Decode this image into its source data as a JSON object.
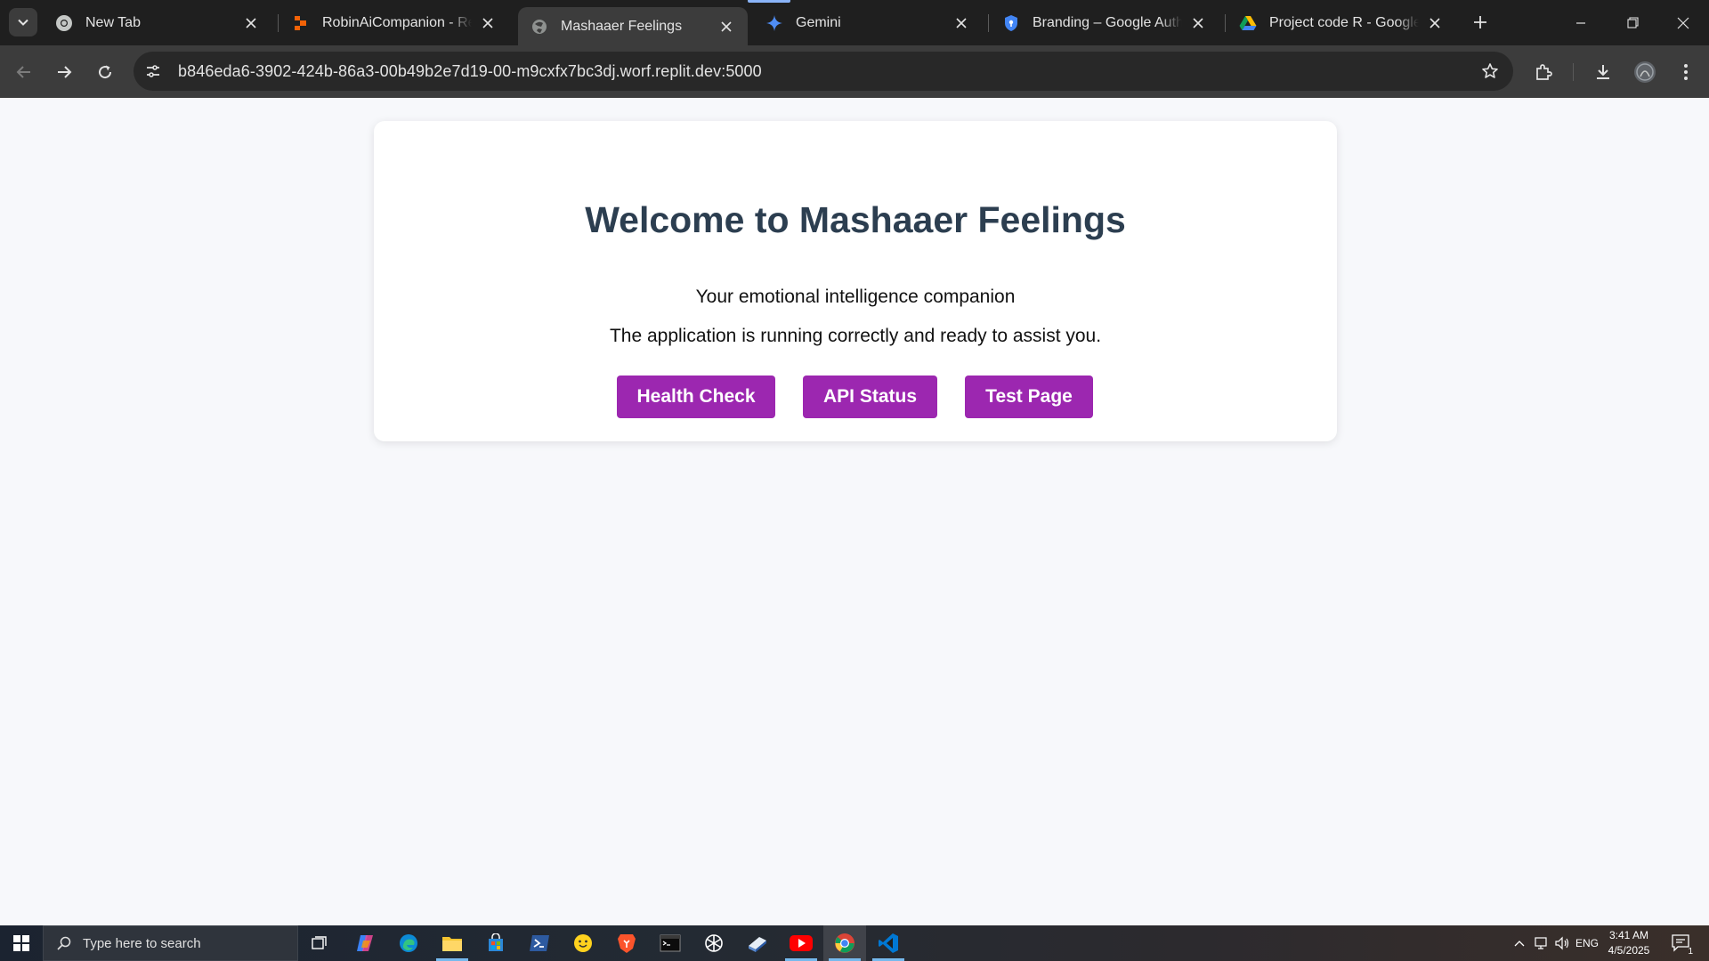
{
  "browser": {
    "tabs": [
      {
        "title": "New Tab",
        "favicon": "chrome-icon"
      },
      {
        "title": "RobinAiCompanion - Replit",
        "favicon": "replit-icon"
      },
      {
        "title": "Mashaaer Feelings",
        "favicon": "globe-icon",
        "active": true
      },
      {
        "title": "Gemini",
        "favicon": "gemini-icon"
      },
      {
        "title": "Branding – Google Auth Platform",
        "favicon": "shield-icon"
      },
      {
        "title": "Project code R - Google Drive",
        "favicon": "google-drive-icon"
      }
    ],
    "url": "b846eda6-3902-424b-86a3-00b49b2e7d19-00-m9cxfx7bc3dj.worf.replit.dev:5000"
  },
  "page": {
    "heading": "Welcome to Mashaaer Feelings",
    "tagline": "Your emotional intelligence companion",
    "status": "The application is running correctly and ready to assist you.",
    "buttons": {
      "health": "Health Check",
      "api": "API Status",
      "test": "Test Page"
    },
    "accent_color": "#9c27b0",
    "heading_color": "#2c3e50"
  },
  "taskbar": {
    "search_placeholder": "Type here to search",
    "language": "ENG",
    "time": "3:41 AM",
    "date": "4/5/2025",
    "notification_count": "1",
    "apps": [
      "task-view-icon",
      "copilot-icon",
      "edge-icon",
      "file-explorer-icon",
      "microsoft-store-icon",
      "powershell-icon",
      "hugging-face-icon",
      "brave-icon",
      "terminal-icon",
      "chatgpt-icon",
      "cursor-icon",
      "youtube-icon",
      "chrome-icon",
      "vscode-icon"
    ]
  }
}
